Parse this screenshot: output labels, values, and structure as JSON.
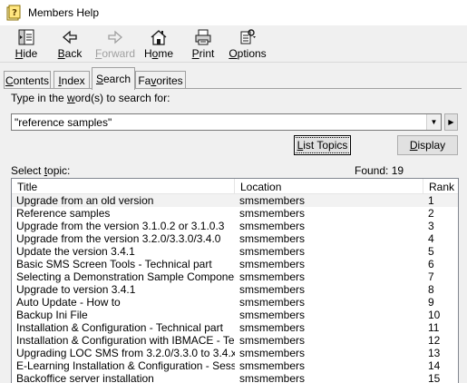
{
  "window": {
    "title": "Members Help"
  },
  "toolbar": {
    "buttons": [
      {
        "pre": "",
        "key": "H",
        "post": "ide",
        "icon": "hide-icon",
        "disabled": false
      },
      {
        "pre": "",
        "key": "B",
        "post": "ack",
        "icon": "back-arrow-icon",
        "disabled": false
      },
      {
        "pre": "",
        "key": "F",
        "post": "orward",
        "icon": "forward-arrow-icon",
        "disabled": true
      },
      {
        "pre": "H",
        "key": "o",
        "post": "me",
        "icon": "home-icon",
        "disabled": false
      },
      {
        "pre": "",
        "key": "P",
        "post": "rint",
        "icon": "printer-icon",
        "disabled": false
      },
      {
        "pre": "",
        "key": "O",
        "post": "ptions",
        "icon": "options-icon",
        "disabled": false
      }
    ]
  },
  "tabs": [
    {
      "pre": "",
      "key": "C",
      "post": "ontents",
      "active": false
    },
    {
      "pre": "",
      "key": "I",
      "post": "ndex",
      "active": false
    },
    {
      "pre": "",
      "key": "S",
      "post": "earch",
      "active": true
    },
    {
      "pre": "Fa",
      "key": "v",
      "post": "orites",
      "active": false
    }
  ],
  "search": {
    "prompt_pre": "Type in the ",
    "prompt_key": "w",
    "prompt_post": "ord(s) to search for:",
    "query": "\"reference samples\"",
    "list_topics": {
      "pre": "",
      "key": "L",
      "post": "ist Topics"
    },
    "display": {
      "pre": "",
      "key": "D",
      "post": "isplay"
    }
  },
  "results": {
    "select_label_pre": "Select ",
    "select_label_key": "t",
    "select_label_post": "opic:",
    "found_label": "Found: 19",
    "columns": [
      "Title",
      "Location",
      "Rank"
    ],
    "rows": [
      {
        "title": "Upgrade from an old version",
        "location": "smsmembers",
        "rank": "1"
      },
      {
        "title": "Reference samples",
        "location": "smsmembers",
        "rank": "2"
      },
      {
        "title": "Upgrade from the version 3.1.0.2 or 3.1.0.3",
        "location": "smsmembers",
        "rank": "3"
      },
      {
        "title": "Upgrade from the version 3.2.0/3.3.0/3.4.0",
        "location": "smsmembers",
        "rank": "4"
      },
      {
        "title": "Update the version 3.4.1",
        "location": "smsmembers",
        "rank": "5"
      },
      {
        "title": "Basic SMS Screen Tools - Technical part",
        "location": "smsmembers",
        "rank": "6"
      },
      {
        "title": "Selecting a Demonstration Sample Component",
        "location": "smsmembers",
        "rank": "7"
      },
      {
        "title": "Upgrade to version 3.4.1",
        "location": "smsmembers",
        "rank": "8"
      },
      {
        "title": "Auto Update - How to",
        "location": "smsmembers",
        "rank": "9"
      },
      {
        "title": "Backup Ini File",
        "location": "smsmembers",
        "rank": "10"
      },
      {
        "title": "Installation & Configuration - Technical part",
        "location": "smsmembers",
        "rank": "11"
      },
      {
        "title": "Installation & Configuration with IBMACE - Techn...",
        "location": "smsmembers",
        "rank": "12"
      },
      {
        "title": "Upgrading LOC SMS from 3.2.0/3.3.0 to 3.4.x - ...",
        "location": "smsmembers",
        "rank": "13"
      },
      {
        "title": "E-Learning Installation & Configuration - Session ...",
        "location": "smsmembers",
        "rank": "14"
      },
      {
        "title": "Backoffice server installation",
        "location": "smsmembers",
        "rank": "15"
      }
    ]
  }
}
